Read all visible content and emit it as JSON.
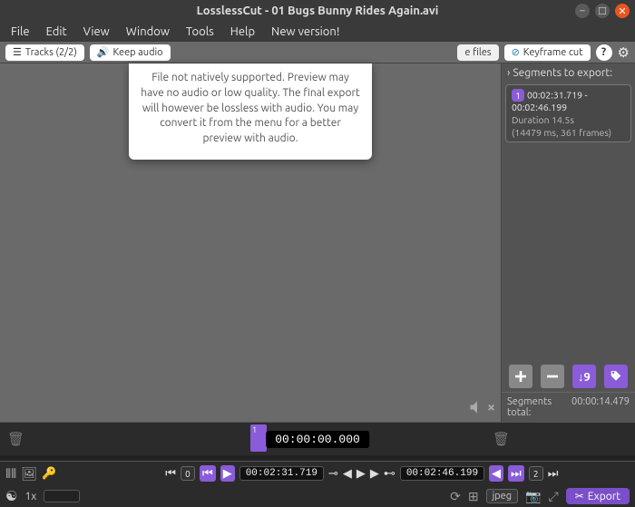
{
  "title": "LosslessCut - 01 Bugs Bunny Rides Again.avi",
  "menu": {
    "file": "File",
    "edit": "Edit",
    "view": "View",
    "window": "Window",
    "tools": "Tools",
    "help": "Help",
    "new": "New version!"
  },
  "toolbar": {
    "tracks": "Tracks (2/2)",
    "keep_audio": "Keep audio",
    "files_frag": "e files",
    "keyframe": "Keyframe cut"
  },
  "tooltip": "File not natively supported. Preview may have no audio or low quality. The final export will however be lossless with audio. You may convert it from the menu for a better preview with audio.",
  "side": {
    "header": "Segments to export:",
    "seg_num": "1",
    "seg_times": "00:02:31.719 - 00:02:46.199",
    "seg_dur_line1": "Duration 14.5s",
    "seg_dur_line2": "(14479 ms, 361 frames)",
    "total_label": "Segments total:",
    "total_time": "00:00:14.479"
  },
  "timeline": {
    "marker": "1",
    "timecode": "00:00:00.000"
  },
  "controls": {
    "left_num": "0",
    "start_tc": "00:02:31.719",
    "end_tc": "00:02:46.199",
    "right_num": "2"
  },
  "bottom": {
    "speed": "1x",
    "jpeg": "jpeg",
    "export": "Export"
  }
}
